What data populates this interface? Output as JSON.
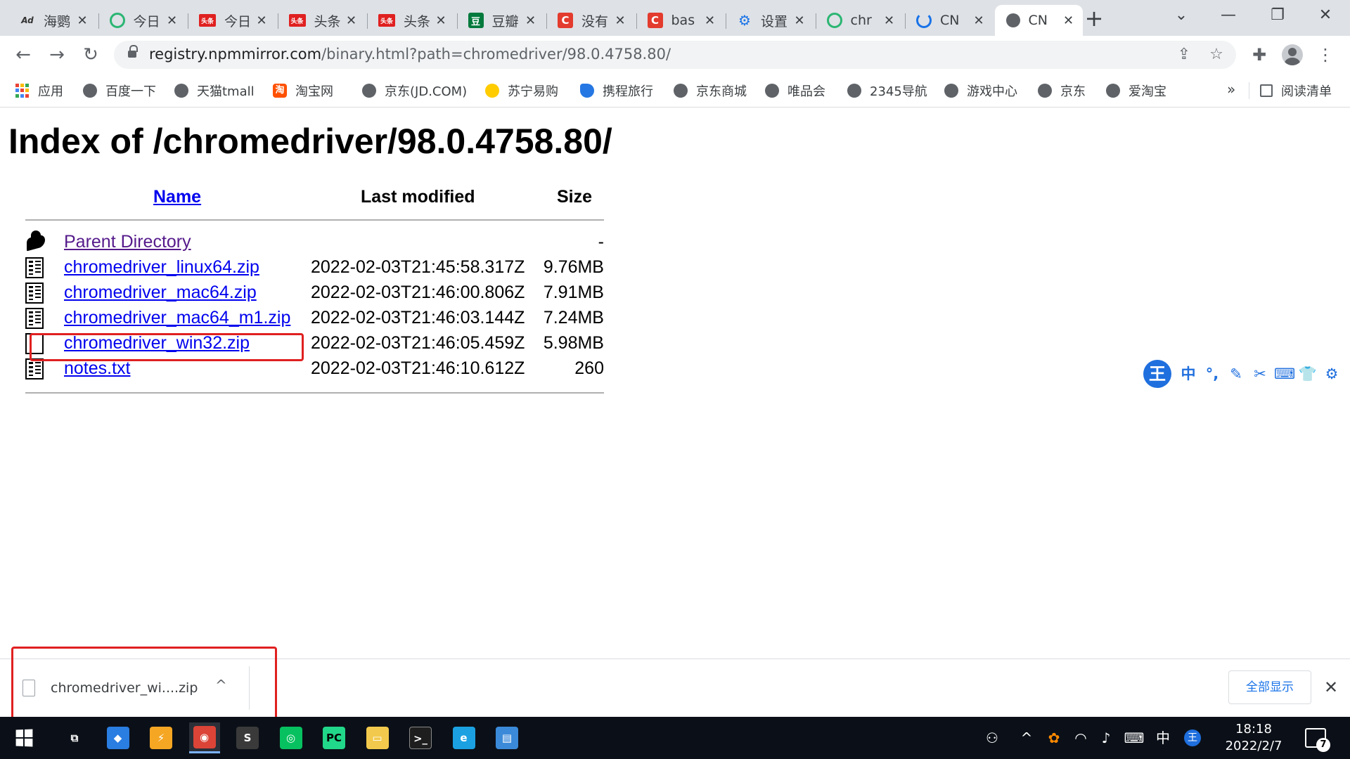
{
  "browser": {
    "tabs": [
      {
        "title": "海鹦",
        "icon": "ad-icon"
      },
      {
        "title": "今日",
        "icon": "circle-icon"
      },
      {
        "title": "今日",
        "icon": "toutiao-icon"
      },
      {
        "title": "头条",
        "icon": "toutiao-icon"
      },
      {
        "title": "头条",
        "icon": "toutiao-icon"
      },
      {
        "title": "豆瓣",
        "icon": "douban-icon"
      },
      {
        "title": "没有",
        "icon": "csdn-icon"
      },
      {
        "title": "bas",
        "icon": "csdn-icon"
      },
      {
        "title": "设置",
        "icon": "gear-icon"
      },
      {
        "title": "chr",
        "icon": "circle-icon"
      },
      {
        "title": "CN",
        "icon": "loading-icon"
      },
      {
        "title": "CN",
        "icon": "globe-icon",
        "active": true
      }
    ],
    "tab_close_glyph": "✕",
    "new_tab_glyph": "+",
    "window_controls": {
      "dropdown": "⌄",
      "minimize": "—",
      "restore": "❐",
      "close": "✕"
    },
    "nav": {
      "back": "←",
      "forward": "→",
      "reload": "↻"
    },
    "url": {
      "host": "registry.npmmirror.com",
      "path": "/binary.html?path=chromedriver/98.0.4758.80/"
    },
    "toolbar_glyphs": {
      "share": "⇪",
      "star": "☆",
      "extensions": "✚",
      "menu": "⋮"
    },
    "bookmarks": [
      {
        "label": "应用",
        "icon": "apps-icon"
      },
      {
        "label": "百度一下",
        "icon": "globe-icon"
      },
      {
        "label": "天猫tmall",
        "icon": "globe-icon"
      },
      {
        "label": "淘宝网",
        "icon": "taobao-icon",
        "glyph": "淘"
      },
      {
        "label": "京东(JD.COM)",
        "icon": "globe-icon"
      },
      {
        "label": "苏宁易购",
        "icon": "suning-icon"
      },
      {
        "label": "携程旅行",
        "icon": "ctrip-icon"
      },
      {
        "label": "京东商城",
        "icon": "globe-icon"
      },
      {
        "label": "唯品会",
        "icon": "globe-icon"
      },
      {
        "label": "2345导航",
        "icon": "globe-icon"
      },
      {
        "label": "游戏中心",
        "icon": "globe-icon"
      },
      {
        "label": "京东",
        "icon": "globe-icon"
      },
      {
        "label": "爱淘宝",
        "icon": "globe-icon"
      }
    ],
    "bookmarks_more": "»",
    "reading_list": "阅读清单"
  },
  "page": {
    "title": "Index of /chromedriver/98.0.4758.80/",
    "columns": {
      "name": "Name",
      "modified": "Last modified",
      "size": "Size"
    },
    "rows": [
      {
        "name": "Parent Directory",
        "modified": "",
        "size": "-",
        "icon": "back-icon"
      },
      {
        "name": "chromedriver_linux64.zip",
        "modified": "2022-02-03T21:45:58.317Z",
        "size": "9.76MB",
        "icon": "binary-file-icon"
      },
      {
        "name": "chromedriver_mac64.zip",
        "modified": "2022-02-03T21:46:00.806Z",
        "size": "7.91MB",
        "icon": "binary-file-icon"
      },
      {
        "name": "chromedriver_mac64_m1.zip",
        "modified": "2022-02-03T21:46:03.144Z",
        "size": "7.24MB",
        "icon": "binary-file-icon"
      },
      {
        "name": "chromedriver_win32.zip",
        "modified": "2022-02-03T21:46:05.459Z",
        "size": "5.98MB",
        "icon": "binary-file-icon"
      },
      {
        "name": "notes.txt",
        "modified": "2022-02-03T21:46:10.612Z",
        "size": "260",
        "icon": "binary-file-icon"
      }
    ]
  },
  "ime": {
    "logo": "王",
    "items": [
      "中",
      "°,",
      "✎",
      "✂",
      "⌨",
      "👕",
      "⚙"
    ]
  },
  "download": {
    "filename": "chromedriver_wi....zip",
    "caret": "^",
    "show_all": "全部显示",
    "close": "✕"
  },
  "taskbar": {
    "apps": [
      {
        "name": "task-view-icon",
        "glyph": "⧉"
      },
      {
        "name": "app-diamond-icon",
        "glyph": "◆"
      },
      {
        "name": "shield-app-icon",
        "glyph": "⚡"
      },
      {
        "name": "chrome-icon",
        "glyph": "◉",
        "active": true
      },
      {
        "name": "sublime-icon",
        "glyph": "S"
      },
      {
        "name": "wechat-icon",
        "glyph": "◎"
      },
      {
        "name": "pycharm-icon",
        "glyph": "PC"
      },
      {
        "name": "file-explorer-icon",
        "glyph": "▭"
      },
      {
        "name": "terminal-icon",
        "glyph": ">_"
      },
      {
        "name": "ie-icon",
        "glyph": "e"
      },
      {
        "name": "control-panel-icon",
        "glyph": "▤"
      }
    ],
    "tray": {
      "people": "⚇",
      "chevron": "^",
      "wifi": "◠",
      "volume": "♪",
      "keyboard": "⌨",
      "ime_lang": "中",
      "ime_logo": "王"
    },
    "time": "18:18",
    "date": "2022/2/7",
    "notification_count": "7"
  }
}
